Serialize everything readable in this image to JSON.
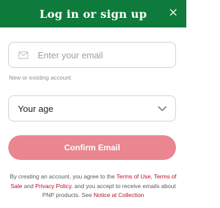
{
  "header": {
    "title": "Log in or sign up",
    "close_icon": "close-icon"
  },
  "email": {
    "placeholder": "Enter your email",
    "value": "",
    "icon": "mail-icon",
    "hint": "New or existing account"
  },
  "age": {
    "selected": "Your age",
    "icon": "chevron-down-icon"
  },
  "confirm": {
    "label": "Confirm Email"
  },
  "legal": {
    "part1": "By creating an account, you agree to the ",
    "terms_of_use": "Terms of Use",
    "part2": ", ",
    "terms_of_sale": "Terms of Sale",
    "part3": " and ",
    "privacy_policy": "Privacy Policy",
    "part4": ", and you accept to receive emails about PNP products. See ",
    "notice": "Notice at Collection"
  },
  "colors": {
    "header_bg": "#0e7a3c",
    "button_bg": "#e9868f",
    "link": "#b1122b"
  }
}
